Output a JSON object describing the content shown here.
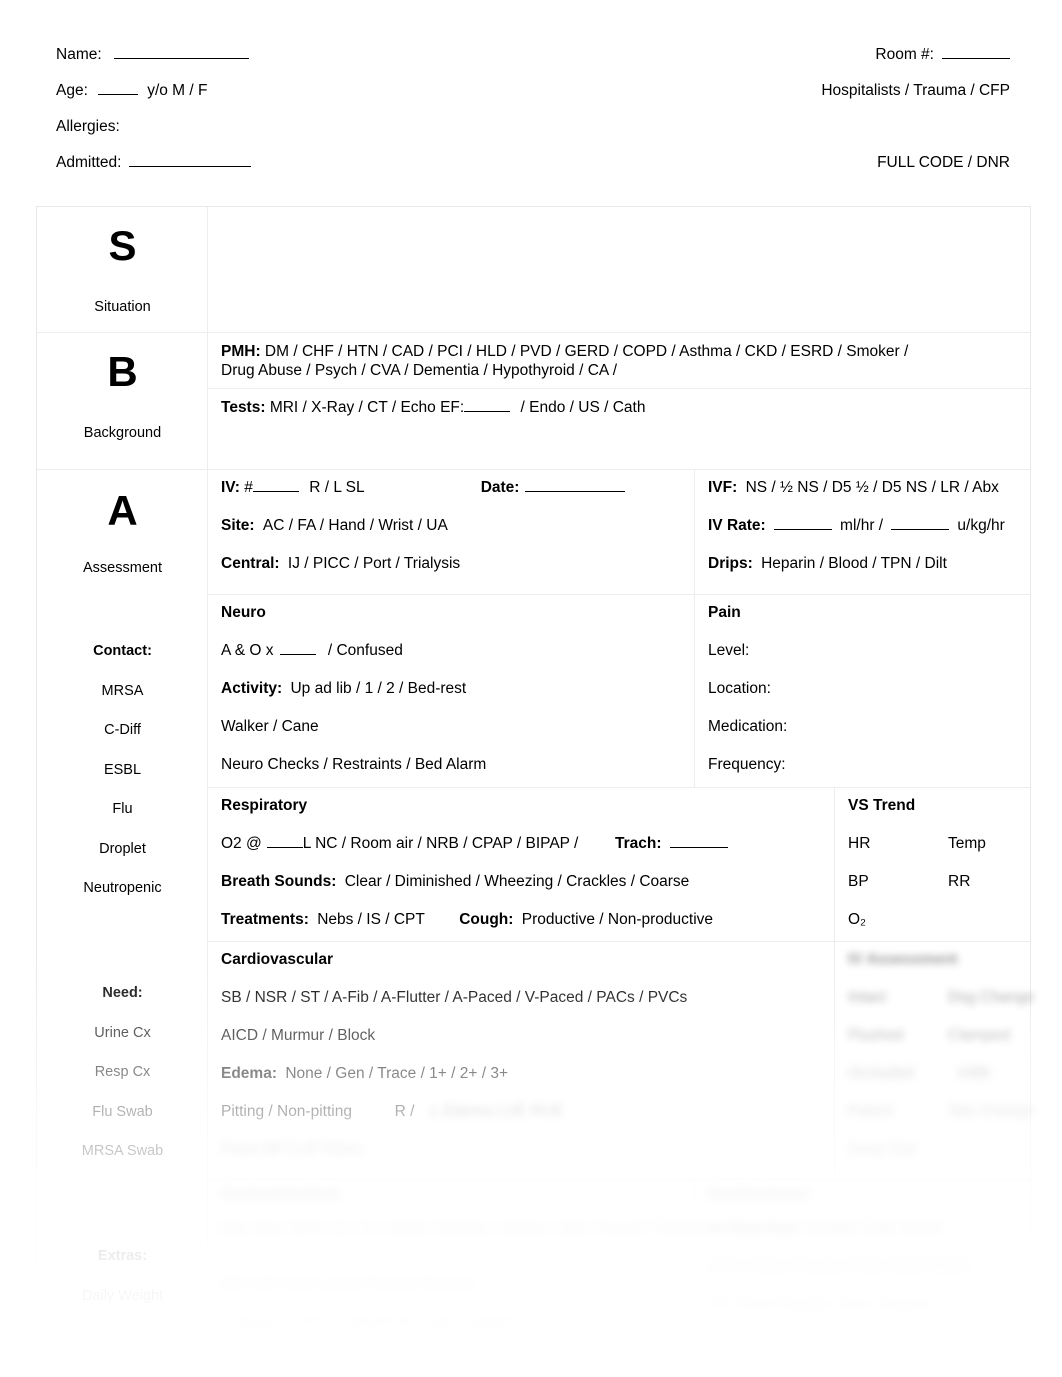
{
  "header": {
    "name_label": "Name:",
    "room_label": "Room #:",
    "age_label": "Age:",
    "age_suffix": "y/o  M  /  F",
    "service_line": "Hospitalists / Trauma  /  CFP",
    "allergies_label": "Allergies:",
    "admitted_label": "Admitted:",
    "code_status": "FULL CODE  /  DNR"
  },
  "sbar": {
    "situation": {
      "letter": "S",
      "word": "Situation"
    },
    "background": {
      "letter": "B",
      "word": "Background"
    },
    "assessment": {
      "letter": "A",
      "word": "Assessment"
    }
  },
  "sidebar": {
    "contact": {
      "heading": "Contact:",
      "items": [
        "MRSA",
        "C-Diff",
        "ESBL",
        "Flu",
        "Droplet",
        "Neutropenic"
      ]
    },
    "need": {
      "heading": "Need:",
      "items": [
        "Urine Cx",
        "Resp Cx",
        "Flu Swab",
        "MRSA Swab"
      ]
    },
    "extras": {
      "heading": "Extras:",
      "items": [
        "Daily Weight"
      ]
    }
  },
  "background": {
    "pmh_label": "PMH:",
    "pmh_line1": "DM  /  CHF  /  HTN  /  CAD  /  PCI  /  HLD  /  PVD  /  GERD  /  COPD  /  Asthma  /  CKD  /  ESRD  /  Smoker  /",
    "pmh_line2": "Drug Abuse  /  Psych  /  CVA  /  Dementia  /  Hypothyroid  /  CA  /",
    "tests_label": "Tests:",
    "tests_line": "MRI    /    X-Ray    /    CT    /    Echo EF:",
    "tests_line_after": "/    Endo    /    US    /    Cath"
  },
  "assessment": {
    "iv": {
      "iv_label": "IV:",
      "iv_value": "#",
      "iv_sides": "R  /  L     SL",
      "date_label": "Date:",
      "site_label": "Site:",
      "site_options": "AC  /  FA  /  Hand  /  Wrist  /  UA",
      "central_label": "Central:",
      "central_options": "IJ  /  PICC  /  Port  /  Trialysis"
    },
    "ivf": {
      "ivf_label": "IVF:",
      "ivf_options": "NS  /  ½ NS  /  D5 ½  /  D5 NS  /  LR  /  Abx",
      "rate_label": "IV Rate:",
      "rate_unit1": "ml/hr      /",
      "rate_unit2": "u/kg/hr",
      "drips_label": "Drips:",
      "drips_options": "Heparin  /  Blood  /  TPN  /  Dilt"
    },
    "neuro": {
      "title": "Neuro",
      "ao_prefix": "A & O x",
      "ao_suffix": "/  Confused",
      "activity_label": "Activity:",
      "activity_options": "Up ad lib  /  1  /  2  /  Bed-rest",
      "assist": "Walker  /  Cane",
      "checks": "Neuro Checks  /  Restraints  /  Bed Alarm"
    },
    "pain": {
      "title": "Pain",
      "level_label": "Level:",
      "location_label": "Location:",
      "medication_label": "Medication:",
      "frequency_label": "Frequency:"
    },
    "respiratory": {
      "title": "Respiratory",
      "o2_prefix": "O2 @",
      "o2_options": "L  NC  /  Room air  /  NRB  /  CPAP  /  BIPAP  /",
      "trach_label": "Trach:",
      "breath_label": "Breath Sounds:",
      "breath_options": "Clear  /  Diminished  /  Wheezing  /  Crackles  /  Coarse",
      "treatments_label": "Treatments:",
      "treatments_options": "Nebs  /  IS  /  CPT",
      "cough_label": "Cough:",
      "cough_options": "Productive  /  Non-productive"
    },
    "vs_trend": {
      "title": "VS Trend",
      "rows": [
        {
          "left": "HR",
          "right": "Temp"
        },
        {
          "left": "BP",
          "right": "RR"
        },
        {
          "left": "O₂",
          "right": ""
        }
      ]
    },
    "cardiovascular": {
      "title": "Cardiovascular",
      "rhythm": "SB  /  NSR  /  ST  /  A-Fib  /  A-Flutter  /  A-Paced  /  V-Paced  /  PACs  /  PVCs",
      "devices": "AICD  /  Murmur  /  Block",
      "edema_label": "Edema:",
      "edema_options": "None  /  Gen  /  Trace  /  1+  /  2+  /  3+",
      "pitting": "Pitting  /  Non-pitting",
      "side_label": "R  /"
    }
  },
  "faded": {
    "cv_tail": "L        Edema         LUE      RUE",
    "cv_tail2": "Pulse     BP Cuff         Telem",
    "vs_faded_title": "IV Assessment",
    "vs_faded_rows": [
      {
        "left": "Intact",
        "right": "Dsg Change"
      },
      {
        "left": "Flushed",
        "right": "Clamped"
      },
      {
        "left": "Occluded",
        "right": "Infiltr"
      },
      {
        "left": "Patent",
        "right": "Site Change"
      },
      {
        "left": "Good Site",
        "right": ""
      }
    ],
    "gi_title": "Gastrointestinal",
    "gi_row1": "Diet:    Reg  /  NPO  /  CL  /  FL  /  Renal  /  Diabetic  /  Cardiac  /  Soft  /  Pureed  /  Thickened  /  Tube Feed",
    "gi_row2": "BM   Soft   Hard   Loose   Formed   Melena",
    "gi_row3": "Colostomy   PEG   Dobhoff   NG Tube   LastBM",
    "gu_title": "Genitourinary",
    "gu_row1": "Voiding   Foley   Straight Cath   Incont",
    "gu_row2": "Urine   Clear   Cloudy   Amber   Dark   Blood",
    "gu_row3": "HD   Shunt   Bladder Scan   Dialysis"
  }
}
